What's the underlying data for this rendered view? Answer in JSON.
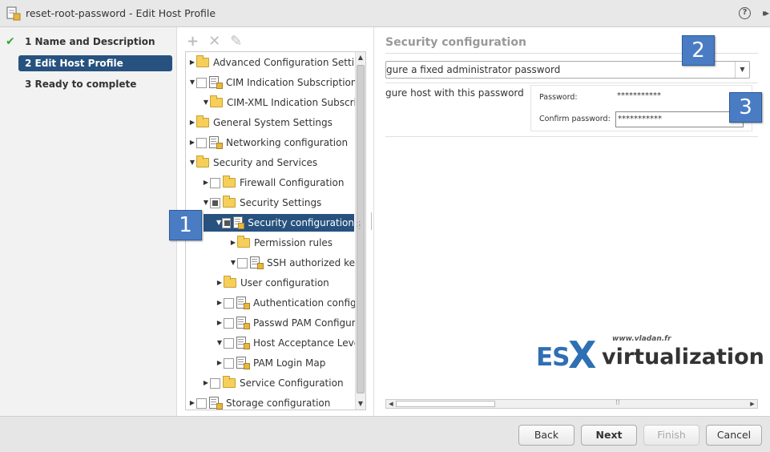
{
  "window": {
    "title": "reset-root-password - Edit Host Profile",
    "help_glyph": "?",
    "expand_glyph": "▸▸"
  },
  "steps": [
    {
      "label": "1  Name and Description",
      "completed": true
    },
    {
      "label": "2  Edit Host Profile",
      "active": true
    },
    {
      "label": "3  Ready to complete"
    }
  ],
  "tree_toolbar": {
    "add": "+",
    "remove": "✕",
    "edit": "✎"
  },
  "tree": [
    {
      "label": "Advanced Configuration Settings",
      "expanded": false,
      "checkbox": false,
      "icon": "folder-icon"
    },
    {
      "label": "CIM Indication Subscriptions",
      "expanded": true,
      "checkbox": true,
      "icon": "profile-icon"
    },
    {
      "label": "CIM-XML Indication Subscript",
      "expanded": true,
      "checkbox": false,
      "icon": "folder-icon"
    },
    {
      "label": "General System Settings",
      "expanded": false,
      "checkbox": false,
      "icon": "folder-icon"
    },
    {
      "label": "Networking configuration",
      "expanded": false,
      "checkbox": true,
      "icon": "profile-icon"
    },
    {
      "label": "Security and Services",
      "expanded": true,
      "checkbox": false,
      "icon": "folder-icon"
    },
    {
      "label": "Firewall Configuration",
      "expanded": false,
      "checkbox": true,
      "icon": "folder-icon"
    },
    {
      "label": "Security Settings",
      "expanded": true,
      "checkbox": true,
      "icon": "folder-icon",
      "partial": true
    },
    {
      "label": "Security configuration",
      "expanded": true,
      "checkbox": true,
      "icon": "profile-icon",
      "partial": true,
      "selected": true
    },
    {
      "label": "Permission rules",
      "expanded": false,
      "checkbox": false,
      "icon": "folder-icon"
    },
    {
      "label": "SSH authorized key f",
      "expanded": true,
      "checkbox": true,
      "icon": "profile-icon"
    },
    {
      "label": "User configuration",
      "expanded": false,
      "checkbox": false,
      "icon": "folder-icon"
    },
    {
      "label": "Authentication configura",
      "expanded": false,
      "checkbox": true,
      "icon": "profile-icon"
    },
    {
      "label": "Passwd PAM Configura",
      "expanded": false,
      "checkbox": true,
      "icon": "profile-icon"
    },
    {
      "label": "Host Acceptance Level",
      "expanded": true,
      "checkbox": true,
      "icon": "profile-icon"
    },
    {
      "label": "PAM Login Map",
      "expanded": false,
      "checkbox": true,
      "icon": "profile-icon"
    },
    {
      "label": "Service Configuration",
      "expanded": false,
      "checkbox": true,
      "icon": "folder-icon"
    },
    {
      "label": "Storage configuration",
      "expanded": false,
      "checkbox": true,
      "icon": "profile-icon"
    }
  ],
  "right": {
    "section_title": "Security configuration",
    "dropdown_value": "gure a fixed administrator password",
    "config_label": "gure host with this password",
    "password_label": "Password:",
    "password_value": "***********",
    "confirm_label": "Confirm password:",
    "confirm_value": "***********"
  },
  "logo": {
    "url": "www.vladan.fr",
    "es": "ES",
    "x": "X",
    "virtualization": "virtualization"
  },
  "callouts": [
    "1",
    "2",
    "3"
  ],
  "footer": {
    "back": "Back",
    "next": "Next",
    "finish": "Finish",
    "cancel": "Cancel"
  }
}
